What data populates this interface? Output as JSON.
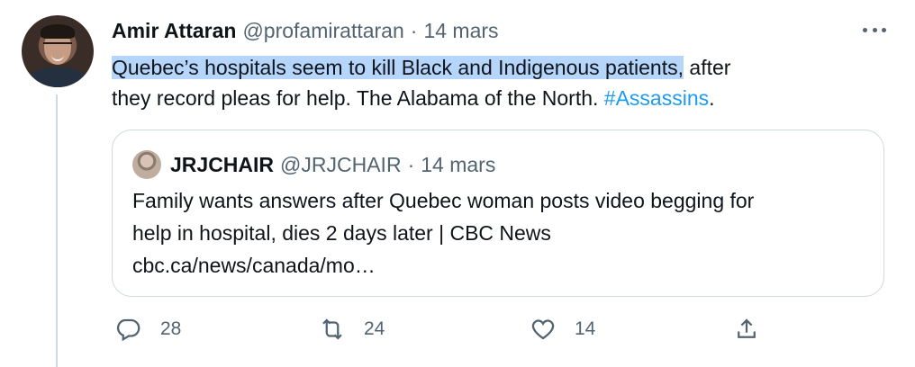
{
  "tweet": {
    "display_name": "Amir Attaran",
    "handle": "@profamirattaran",
    "date": "14 mars",
    "separator": "·",
    "text_highlighted": "Quebec’s hospitals seem to kill Black and Indigenous patients,",
    "text_line1_rest": " after",
    "text_rest": "they record pleas for help.  The Alabama of the North.  ",
    "hashtag": "#Assassins",
    "text_end": ".",
    "avatar_icon": "profile-photo",
    "more_icon": "more-horizontal-icon"
  },
  "quote": {
    "display_name": "JRJCHAIR",
    "handle": "@JRJCHAIR",
    "date": "14 mars",
    "separator": "·",
    "line1": "Family wants answers after Quebec woman posts video begging for",
    "line2": "help in hospital, dies 2 days later | CBC News",
    "line3": "cbc.ca/news/canada/mo…"
  },
  "actions": {
    "reply_count": "28",
    "retweet_count": "24",
    "like_count": "14",
    "reply_icon": "reply-icon",
    "retweet_icon": "retweet-icon",
    "like_icon": "heart-icon",
    "share_icon": "share-icon"
  },
  "colors": {
    "highlight": "#b6d5fb",
    "link": "#1d9bf0",
    "secondary_text": "#536471",
    "border": "#cfd9de"
  }
}
